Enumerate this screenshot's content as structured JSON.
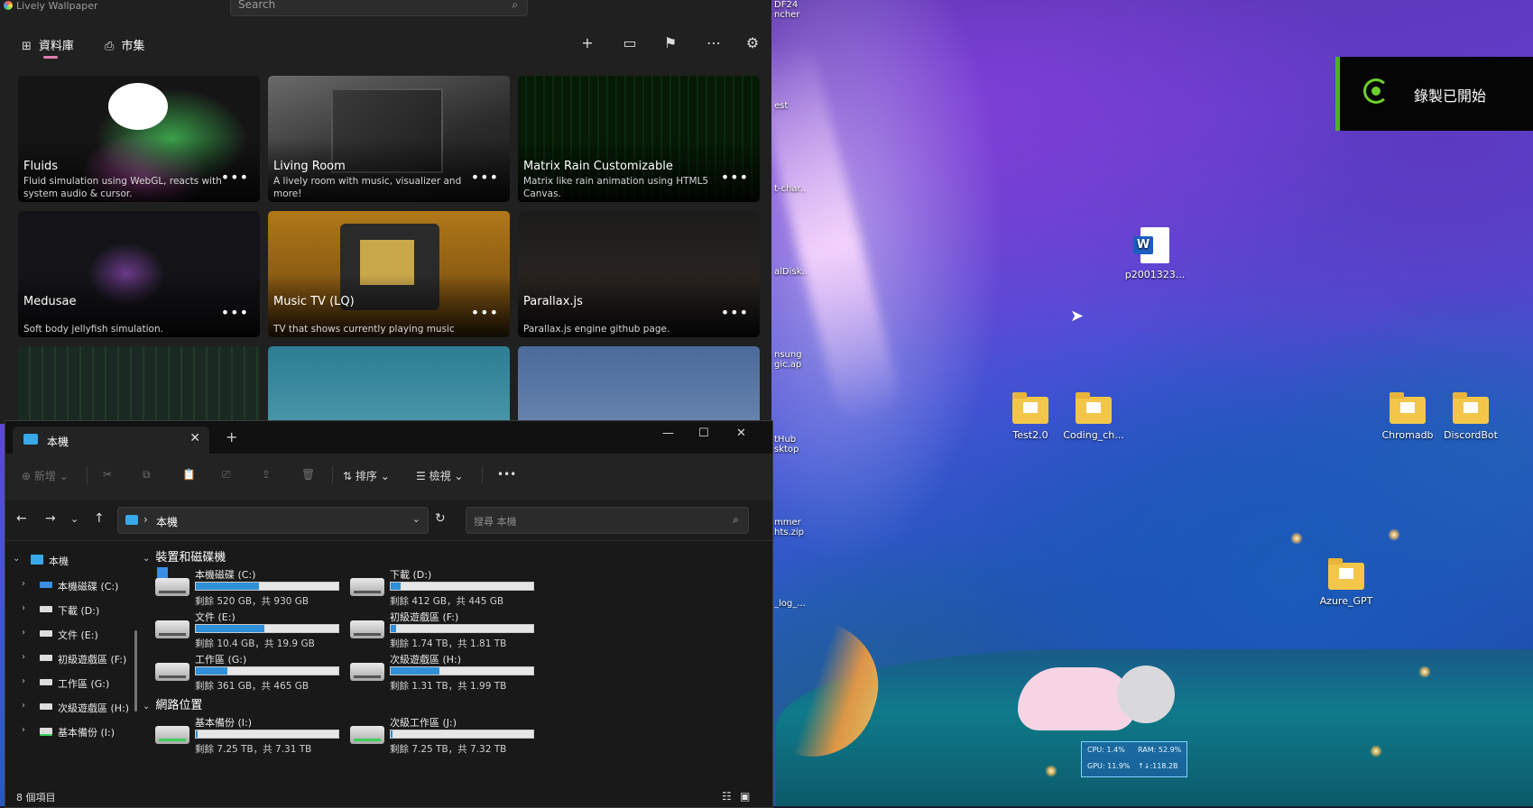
{
  "lively": {
    "app_title": "Lively Wallpaper",
    "search_placeholder": "Search",
    "tabs": [
      {
        "label": "資料庫"
      },
      {
        "label": "市集"
      }
    ],
    "toolbar_icons": [
      "add-icon",
      "display-icon",
      "control-panel-icon",
      "more-icon",
      "settings-icon"
    ],
    "wallpapers": [
      {
        "title": "Fluids",
        "desc": "Fluid simulation using WebGL, reacts with system audio & cursor."
      },
      {
        "title": "Living Room",
        "desc": "A lively room with music, visualizer and more!"
      },
      {
        "title": "Matrix Rain Customizable",
        "desc": "Matrix like rain animation using HTML5 Canvas."
      },
      {
        "title": "Medusae",
        "desc": "Soft body jellyfish simulation."
      },
      {
        "title": "Music TV (LQ)",
        "desc": "TV that shows currently playing music"
      },
      {
        "title": "Parallax.js",
        "desc": "Parallax.js engine github page."
      }
    ],
    "more_label": "•••"
  },
  "explorer": {
    "tab_label": "本機",
    "new_button": "新增",
    "sort_button": "排序",
    "view_button": "檢視",
    "more_label": "•••",
    "address": "本機",
    "search_placeholder": "搜尋 本機",
    "sidebar": [
      {
        "label": "本機"
      },
      {
        "label": "本機磁碟 (C:)"
      },
      {
        "label": "下載 (D:)"
      },
      {
        "label": "文件 (E:)"
      },
      {
        "label": "初級遊戲區 (F:)"
      },
      {
        "label": "工作區 (G:)"
      },
      {
        "label": "次級遊戲區 (H:)"
      },
      {
        "label": "基本備份 (I:)"
      }
    ],
    "groups": {
      "devices": "裝置和磁碟機",
      "network": "網路位置"
    },
    "drives": [
      {
        "name": "本機磁碟 (C:)",
        "info": "剩餘 520 GB，共 930 GB",
        "used_fraction": 0.44
      },
      {
        "name": "下載 (D:)",
        "info": "剩餘 412 GB，共 445 GB",
        "used_fraction": 0.07
      },
      {
        "name": "文件 (E:)",
        "info": "剩餘 10.4 GB，共 19.9 GB",
        "used_fraction": 0.48
      },
      {
        "name": "初級遊戲區 (F:)",
        "info": "剩餘 1.74 TB，共 1.81 TB",
        "used_fraction": 0.04
      },
      {
        "name": "工作區 (G:)",
        "info": "剩餘 361 GB，共 465 GB",
        "used_fraction": 0.22
      },
      {
        "name": "次級遊戲區 (H:)",
        "info": "剩餘 1.31 TB，共 1.99 TB",
        "used_fraction": 0.34
      },
      {
        "name": "基本備份 (I:)",
        "info": "剩餘 7.25 TB，共 7.31 TB",
        "used_fraction": 0.01
      },
      {
        "name": "次級工作區 (J:)",
        "info": "剩餘 7.25 TB，共 7.32 TB",
        "used_fraction": 0.01
      }
    ],
    "status_count": "8 個項目"
  },
  "desktop": {
    "icons": [
      {
        "label": "p2001323..."
      },
      {
        "label": "Test2.0"
      },
      {
        "label": "Coding_ch..."
      },
      {
        "label": "Chromadb"
      },
      {
        "label": "DiscordBot"
      },
      {
        "label": "Azure_GPT"
      }
    ],
    "partial_icons": [
      "DF24\nncher",
      "est",
      "t-char..",
      "alDisk..",
      "nsung\ngic.ap",
      "tHub\nsktop",
      "mmer\nhts.zip",
      "_log_..."
    ]
  },
  "toast": {
    "message": "錄製已開始"
  },
  "monitor": {
    "cpu": "CPU: 1.4%",
    "ram": "RAM: 52.9%",
    "gpu": "GPU: 11.9%",
    "net": "↑↓:118.2B"
  }
}
